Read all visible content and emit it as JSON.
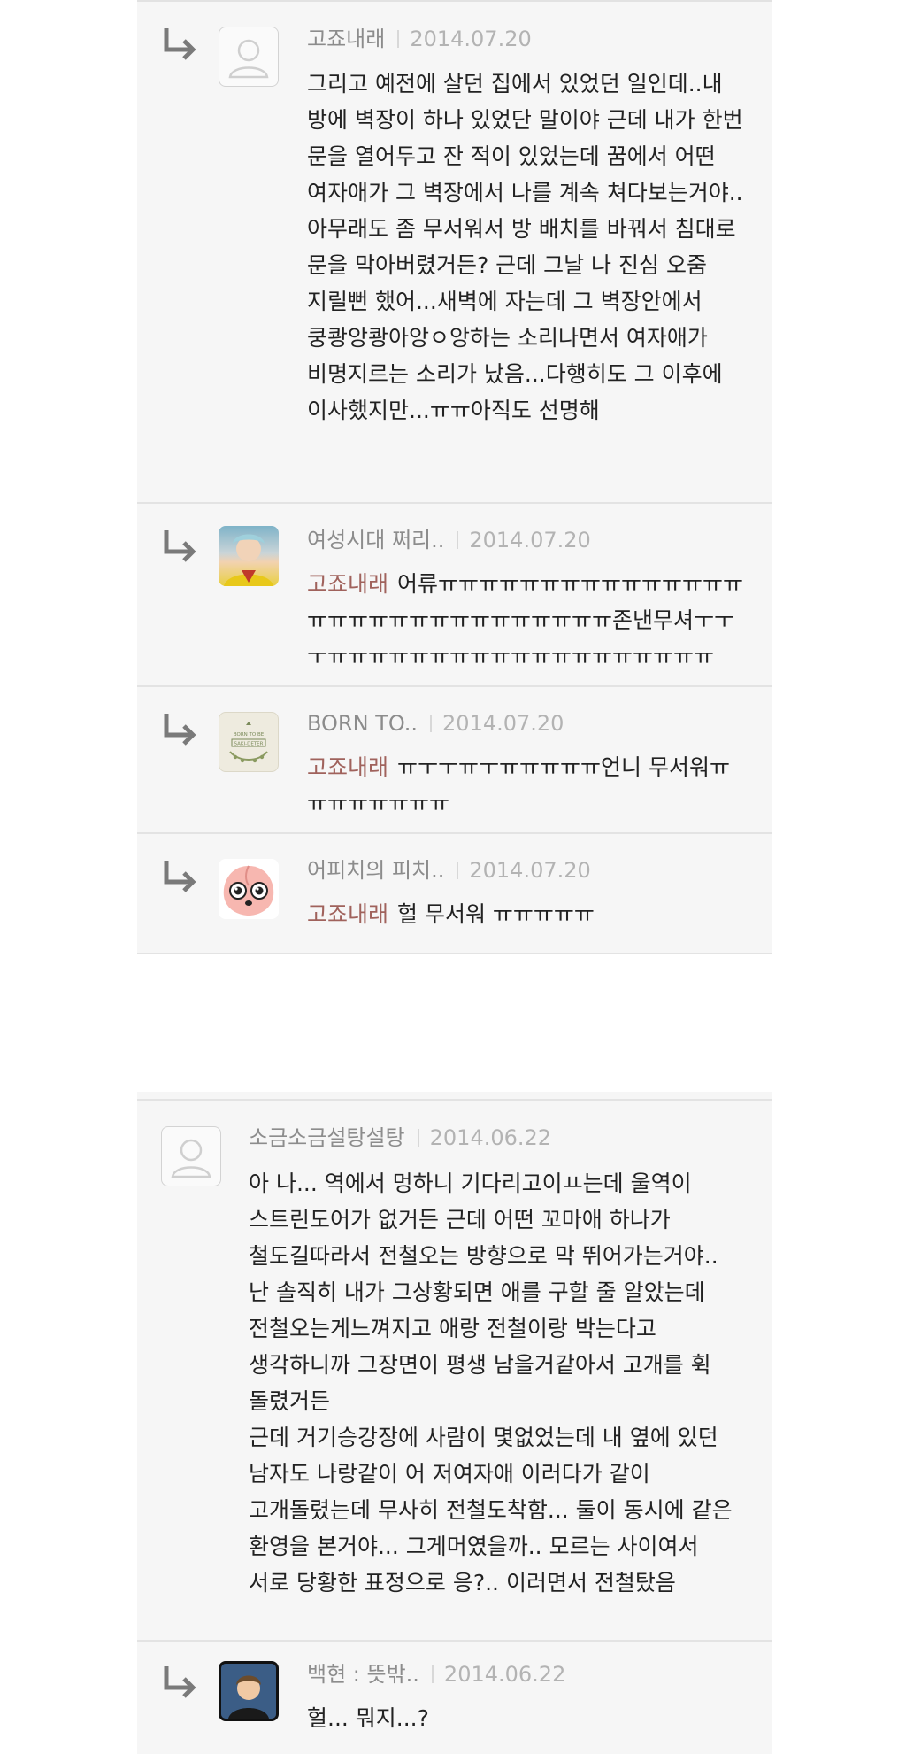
{
  "comments": [
    {
      "author": "고죠내래",
      "date": "2014.07.20",
      "text": "그리고 예전에 살던 집에서 있었던 일인데..내 방에 벽장이 하나 있었단 말이야 근데 내가 한번 문을 열어두고 잔 적이 있었는데 꿈에서 어떤 여자애가 그 벽장에서 나를 계속 쳐다보는거야..아무래도 좀 무서워서 방 배치를 바꿔서 침대로 문을 막아버렸거든? 근데 그날 나 진심 오줌 지릴뻔 했어...새벽에 자는데 그 벽장안에서 쿵쾅앙쾅아앙ㅇ앙하는 소리나면서 여자애가 비명지르는 소리가 났음...다행히도 그 이후에 이사했지만...ㅠㅠ아직도 선명해"
    },
    {
      "author": "여성시대 쩌리..",
      "date": "2014.07.20",
      "mention": "고죠내래",
      "text": "어류ㅠㅠㅠㅠㅠㅠㅠㅠㅠㅠㅠㅠㅠㅠㅠㅠㅠㅠㅠㅠㅠㅠㅠㅠㅠㅠㅠㅠㅠㅠ존낸무셔ㅜㅜㅜㅠㅠㅠㅠㅠㅠㅠㅠㅠㅠㅠㅠㅠㅠㅠㅠㅠㅠㅠ"
    },
    {
      "author": "BORN TO..",
      "date": "2014.07.20",
      "mention": "고죠내래",
      "text": "ㅠㅜㅜㅠㅜㅠㅠㅠㅠㅠ언니 무서워ㅠㅠㅠㅠㅠㅠㅠㅠ"
    },
    {
      "author": "어피치의 피치..",
      "date": "2014.07.20",
      "mention": "고죠내래",
      "text": "헐 무서워 ㅠㅠㅠㅠㅠ"
    },
    {
      "author": "소금소금설탕설탕",
      "date": "2014.06.22",
      "text_lines": [
        "아 나... 역에서 멍하니 기다리고이ㅛ는데 울역이 스트린도어가 없거든 근데 어떤 꼬마애 하나가 철도길따라서 전철오는 방향으로 막 뛰어가는거야.. 난 솔직히 내가 그상황되면 애를 구할 줄 알았는데 전철오는게느껴지고 애랑 전철이랑 박는다고 생각하니까 그장면이 평생 남을거같아서 고개를 휙 돌렸거든",
        "근데 거기승강장에 사람이 몇없었는데 내 옆에 있던 남자도 나랑같이 어 저여자애 이러다가 같이 고개돌렸는데 무사히 전철도착함... 둘이 동시에 같은 환영을 본거야... 그게머였을까.. 모르는 사이여서 서로 당황한 표정으로 응?.. 이러면서 전철탔음"
      ]
    },
    {
      "author": "백현 : 뜻밖..",
      "date": "2014.06.22",
      "text": "헐... 뭐지...?"
    }
  ],
  "avatar_labels": {
    "born_to": "BORN TO BE SAKI-DETER"
  }
}
